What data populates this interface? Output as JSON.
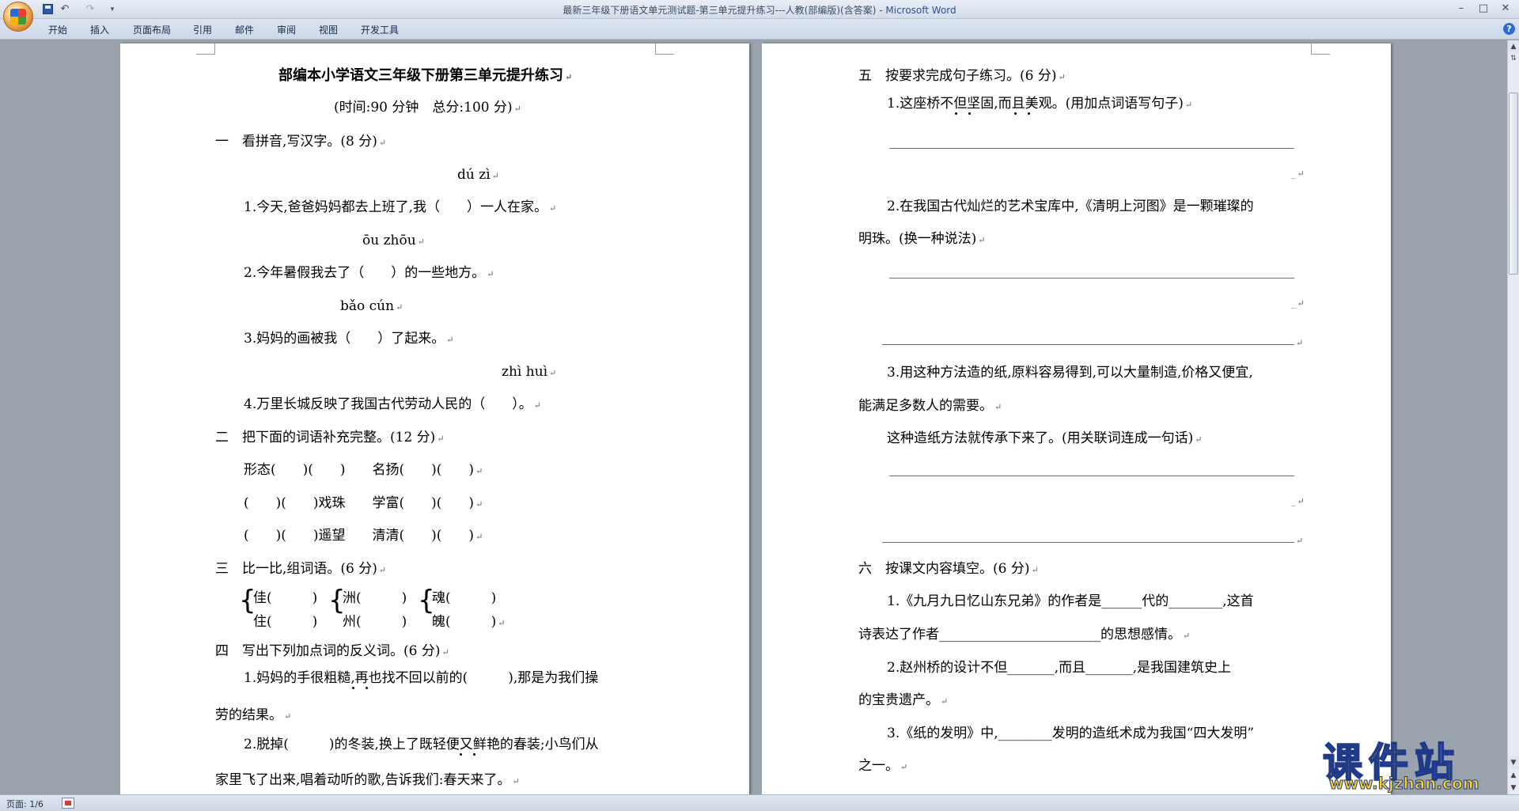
{
  "window": {
    "title": "最新三年级下册语文单元测试题-第三单元提升练习---人教(部编版)(含答案)",
    "separator": " - ",
    "app_name": "Microsoft Word",
    "minimize_glyph": "–",
    "maximize_glyph": "□",
    "close_glyph": "✕"
  },
  "quick_access": {
    "undo_glyph": "↶",
    "redo_glyph": "↷",
    "more_glyph": "▾"
  },
  "ribbon": {
    "tabs": [
      {
        "label": "开始"
      },
      {
        "label": "插入"
      },
      {
        "label": "页面布局"
      },
      {
        "label": "引用"
      },
      {
        "label": "邮件"
      },
      {
        "label": "审阅"
      },
      {
        "label": "视图"
      },
      {
        "label": "开发工具"
      }
    ],
    "help_glyph": "?"
  },
  "page1": {
    "title": "部编本小学语文三年级下册第三单元提升练习",
    "subtitle": "(时间:90 分钟　总分:100 分)",
    "s1_heading": "一　看拼音,写汉字。(8 分)",
    "p1": "dú zì",
    "q1": "1.今天,爸爸妈妈都去上班了,我（　　）一人在家。",
    "p2": "ōu  zhōu",
    "q2": "2.今年暑假我去了（　　）的一些地方。",
    "p3": "bǎo  cún",
    "q3": "3.妈妈的画被我（　　）了起来。",
    "p4": "zhì huì",
    "q4": "4.万里长城反映了我国古代劳动人民的（　　）。",
    "s2_heading": "二　把下面的词语补充完整。(12 分)",
    "r1": "形态(　　)(　　)　　名扬(　　)(　　)",
    "r2": "(　　)(　　)戏珠　　学富(　　)(　　)",
    "r3": "(　　)(　　)遥望　　清清(　　)(　　)",
    "s3_heading": "三　比一比,组词语。(6 分)",
    "c1a": "佳(　　　)",
    "c1b": "住(　　　)",
    "c2a": "洲(　　　)",
    "c2b": "州(　　　)",
    "c3a": "魂(　　　)",
    "c3b": "魄(　　　)",
    "brace": "{",
    "s4_heading": "四　写出下列加点词的反义词。(6 分)",
    "a1": "1.妈妈的手很粗糙,再也找不回以前的(　　　),那是为我们操",
    "a1b": "劳的结果。",
    "a2": "2.脱掉(　　　)的冬装,换上了既轻便又鲜艳的春装;小鸟们从",
    "a2b": "家里飞了出来,唱着动听的歌,告诉我们:春天来了。"
  },
  "page2": {
    "s5_heading": "五　按要求完成句子练习。(6 分)",
    "b1": "1.这座桥不但坚固,而且美观。(用加点词语写句子)",
    "b2": "2.在我国古代灿烂的艺术宝库中,《清明上河图》是一颗璀璨的",
    "b2b": "明珠。(换一种说法)",
    "b3": "3.用这种方法造的纸,原料容易得到,可以大量制造,价格又便宜,",
    "b3b": "能满足多数人的需要。",
    "b3c": "这种造纸方法就传承下来了。(用关联词连成一句话)",
    "s6_heading": "六　按课文内容填空。(6 分)",
    "d1": "1.《九月九日忆山东兄弟》的作者是______代的________,这首",
    "d1b": "诗表达了作者________________________的思想感情。",
    "d2": "2.赵州桥的设计不但_______,而且_______,是我国建筑史上",
    "d2b": "的宝贵遗产。",
    "d3": "3.《纸的发明》中,________发明的造纸术成为我国“四大发明”",
    "d3b": "之一。"
  },
  "marks": {
    "return": "↵",
    "underscore": "_"
  },
  "scrollbar": {
    "up": "▲",
    "ruler": "⇅",
    "down": "▼",
    "prev": "▲",
    "next": "▼"
  },
  "status": {
    "page": "页面: 1/6"
  },
  "watermark": {
    "text": "课件站",
    "url": "www.kjzhan.com"
  },
  "colors": {
    "answer_line": "#e21ee0",
    "title_app": "#2f4f8f"
  }
}
